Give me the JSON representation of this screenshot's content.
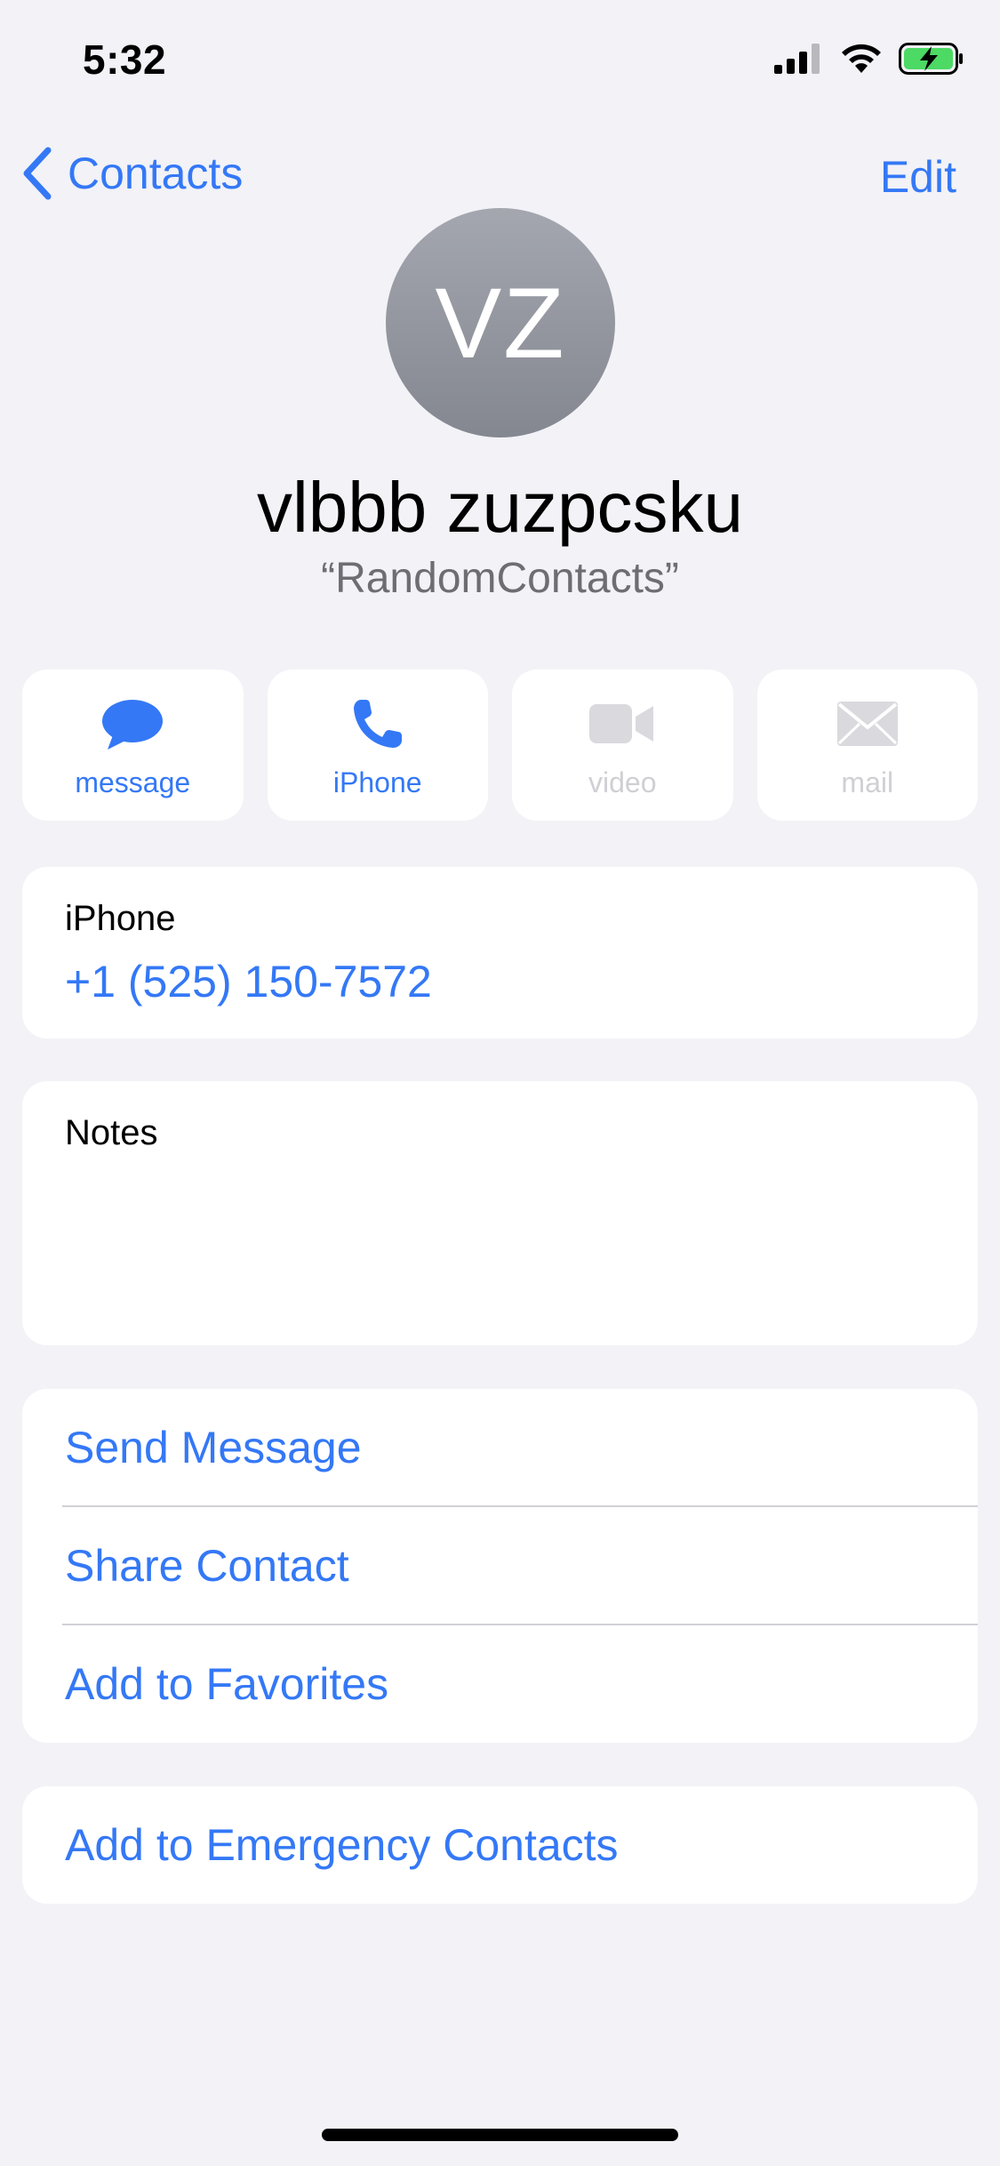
{
  "status_bar": {
    "time": "5:32"
  },
  "nav": {
    "back_label": "Contacts",
    "edit_label": "Edit"
  },
  "contact": {
    "initials": "VZ",
    "name": "vlbbb zuzpcsku",
    "subtitle": "“RandomContacts”"
  },
  "actions": [
    {
      "label": "message",
      "icon": "message-bubble-icon",
      "enabled": true
    },
    {
      "label": "iPhone",
      "icon": "phone-icon",
      "enabled": true
    },
    {
      "label": "video",
      "icon": "video-camera-icon",
      "enabled": false
    },
    {
      "label": "mail",
      "icon": "envelope-icon",
      "enabled": false
    }
  ],
  "phone": {
    "label": "iPhone",
    "number": "+1 (525) 150-7572"
  },
  "notes": {
    "label": "Notes"
  },
  "links": [
    {
      "label": "Send Message"
    },
    {
      "label": "Share Contact"
    },
    {
      "label": "Add to Favorites"
    }
  ],
  "emergency": {
    "label": "Add to Emergency Contacts"
  },
  "colors": {
    "accent": "#3478f6",
    "background": "#f2f2f7",
    "disabled": "#cfcfd4",
    "battery_fill": "#4cd964"
  }
}
